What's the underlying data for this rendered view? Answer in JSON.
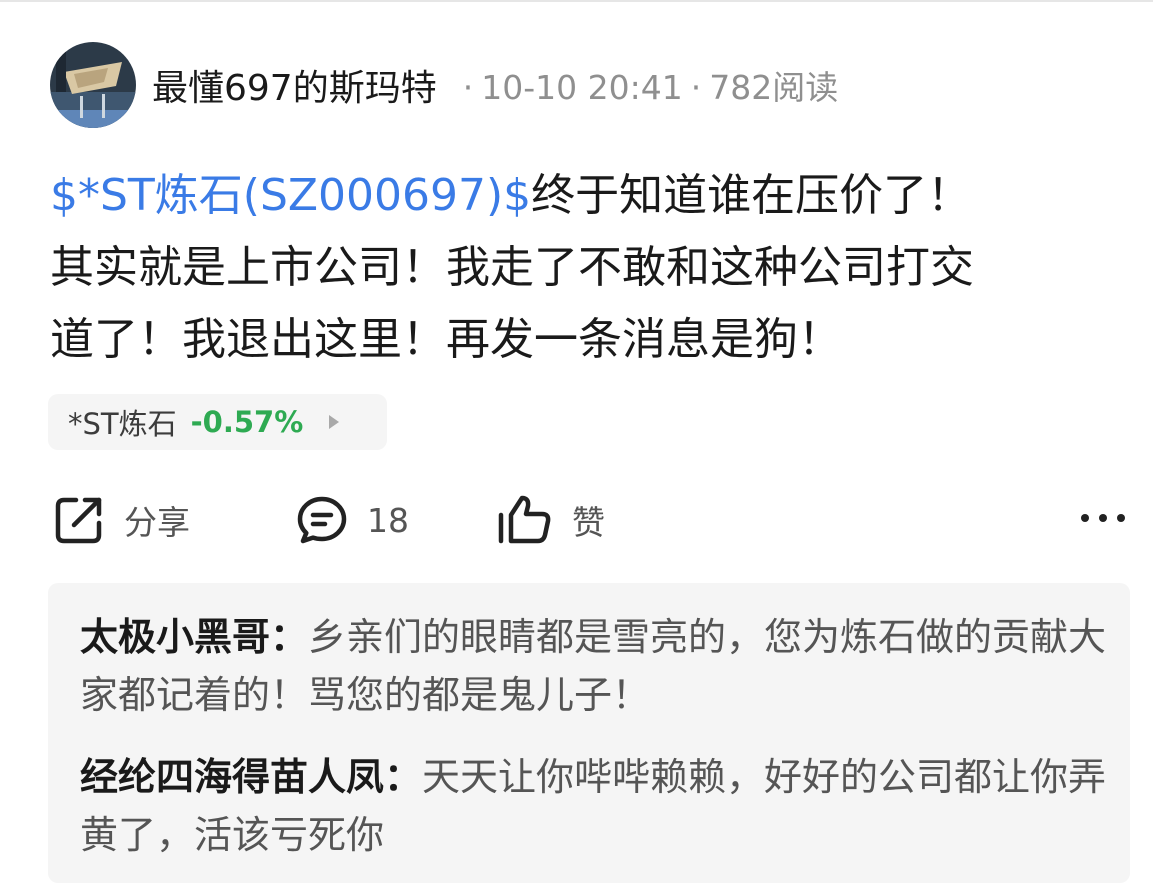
{
  "post": {
    "author": "最懂697的斯玛特",
    "meta_date": "10-10 20:41",
    "meta_reads": "782阅读",
    "stock_tag": "$*ST炼石(SZ000697)$",
    "body_line1": "终于知道谁在压价了！",
    "body_line2": "其实就是上市公司！我走了不敢和这种公司打交",
    "body_line3": "道了！我退出这里！再发一条消息是狗！"
  },
  "stock_chip": {
    "name": "*ST炼石",
    "change": "-0.57%",
    "change_color": "#2eaa52"
  },
  "actions": {
    "share_label": "分享",
    "comment_count": "18",
    "like_label": "赞"
  },
  "comments": [
    {
      "name": "太极小黑哥",
      "text": "乡亲们的眼睛都是雪亮的，您为炼石做的贡献大家都记着的！骂您的都是鬼儿子！"
    },
    {
      "name": "经纶四海得苗人凤",
      "text": "天天让你哔哔赖赖，好好的公司都让你弄黄了，活该亏死你"
    }
  ],
  "colors": {
    "link": "#3a7be6",
    "text": "#1a1a1a",
    "meta": "#8f8f8f",
    "panel_bg": "#f5f5f5"
  },
  "icons": {
    "share": "share-icon",
    "comment": "comment-icon",
    "like": "thumbs-up-icon",
    "more": "more-horizontal-icon"
  }
}
